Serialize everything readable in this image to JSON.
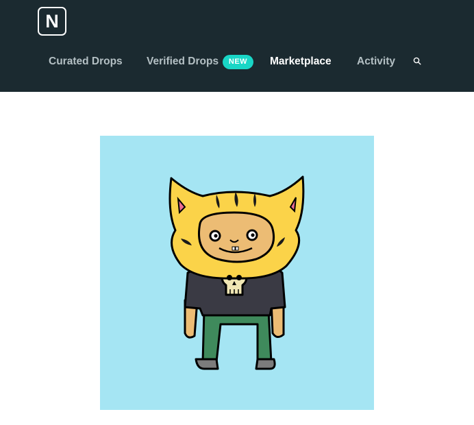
{
  "header": {
    "logo_letter": "N",
    "nav": {
      "curated_drops": "Curated Drops",
      "verified_drops": "Verified Drops",
      "new_badge": "NEW",
      "marketplace": "Marketplace",
      "activity": "Activity"
    },
    "search_icon": "search-icon"
  },
  "colors": {
    "header_bg": "#1b2a30",
    "badge_bg": "#19d6c6",
    "artwork_bg": "#a5e5f3"
  }
}
